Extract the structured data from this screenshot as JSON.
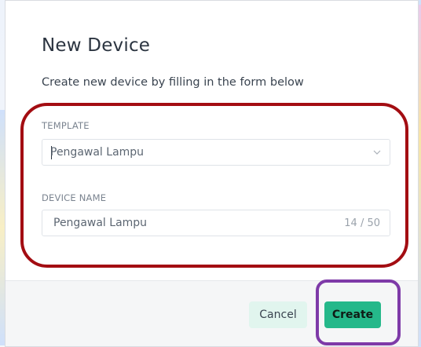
{
  "dialog": {
    "title": "New Device",
    "subtitle": "Create new device by filling in the form below"
  },
  "form": {
    "template": {
      "label": "TEMPLATE",
      "value": "Pengawal Lampu",
      "icon": "chevron-down-icon"
    },
    "device_name": {
      "label": "DEVICE NAME",
      "value": "Pengawal Lampu",
      "counter": "14 / 50"
    }
  },
  "footer": {
    "cancel_label": "Cancel",
    "create_label": "Create"
  },
  "colors": {
    "primary": "#25b88a",
    "cancel_bg": "#e1f5ee",
    "annotation_red": "#a30d12",
    "annotation_purple": "#7e3aa8"
  }
}
